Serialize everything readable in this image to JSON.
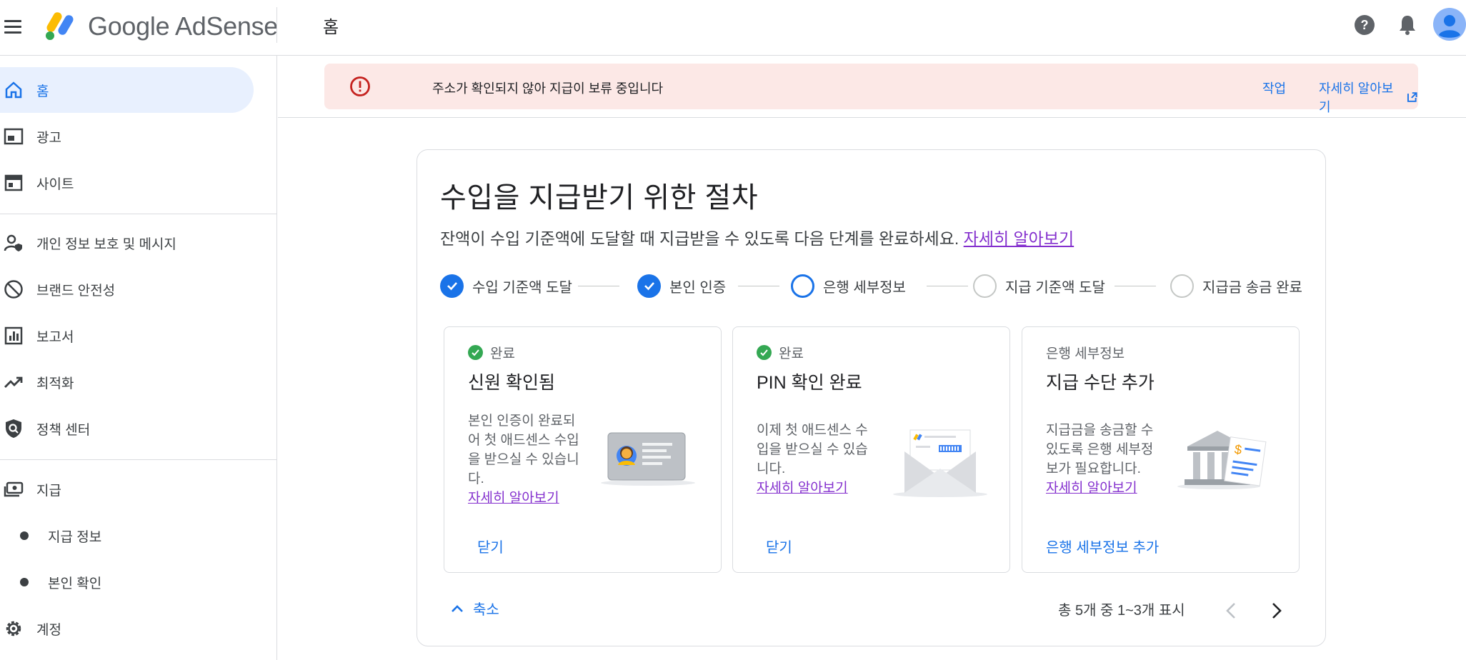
{
  "app": {
    "brand": "Google AdSense",
    "page_title": "홈"
  },
  "sidebar": {
    "items": [
      {
        "label": "홈",
        "icon": "home-icon"
      },
      {
        "label": "광고",
        "icon": "ads-icon"
      },
      {
        "label": "사이트",
        "icon": "sites-icon"
      },
      {
        "label": "개인 정보 보호 및 메시지",
        "icon": "privacy-icon"
      },
      {
        "label": "브랜드 안전성",
        "icon": "block-icon"
      },
      {
        "label": "보고서",
        "icon": "reports-icon"
      },
      {
        "label": "최적화",
        "icon": "trending-icon"
      },
      {
        "label": "정책 센터",
        "icon": "policy-shield-icon"
      },
      {
        "label": "지급",
        "icon": "payments-icon"
      },
      {
        "label": "지급 정보",
        "icon": "bullet-icon"
      },
      {
        "label": "본인 확인",
        "icon": "bullet-icon"
      },
      {
        "label": "계정",
        "icon": "gear-icon"
      }
    ]
  },
  "banner": {
    "message": "주소가 확인되지 않아 지급이 보류 중입니다",
    "action": "작업",
    "learn_more": "자세히 알아보기"
  },
  "card": {
    "title": "수입을 지급받기 위한 절차",
    "description": "잔액이 수입 기준액에 도달할 때 지급받을 수 있도록 다음 단계를 완료하세요.",
    "description_link": "자세히 알아보기",
    "steps": [
      {
        "label": "수입 기준액 도달",
        "state": "done"
      },
      {
        "label": "본인 인증",
        "state": "done"
      },
      {
        "label": "은행 세부정보",
        "state": "current"
      },
      {
        "label": "지급 기준액 도달",
        "state": "todo"
      },
      {
        "label": "지급금 송금 완료",
        "state": "todo"
      }
    ],
    "tasks": [
      {
        "status": "완료",
        "title": "신원 확인됨",
        "body_lines": [
          "본인 인증이 완료되",
          "어 첫 애드센스 수입",
          "을 받으실 수 있습니",
          "다."
        ],
        "link": "자세히 알아보기",
        "action": "닫기"
      },
      {
        "status": "완료",
        "title": "PIN 확인 완료",
        "body_lines": [
          "이제 첫 애드센스 수",
          "입을 받으실 수 있습",
          "니다."
        ],
        "link": "자세히 알아보기",
        "action": "닫기"
      },
      {
        "status": "은행 세부정보",
        "title": "지급 수단 추가",
        "body_lines": [
          "지급금을 송금할 수",
          "있도록 은행 세부정",
          "보가 필요합니다."
        ],
        "link": "자세히 알아보기",
        "action": "은행 세부정보 추가"
      }
    ],
    "collapse_label": "축소",
    "pager_text": "총 5개 중 1~3개 표시"
  },
  "colors": {
    "accent": "#1a73e8",
    "banner_bg": "#fce8e6",
    "error": "#c5221f",
    "success": "#34a853",
    "link_visited": "#8430ce"
  }
}
